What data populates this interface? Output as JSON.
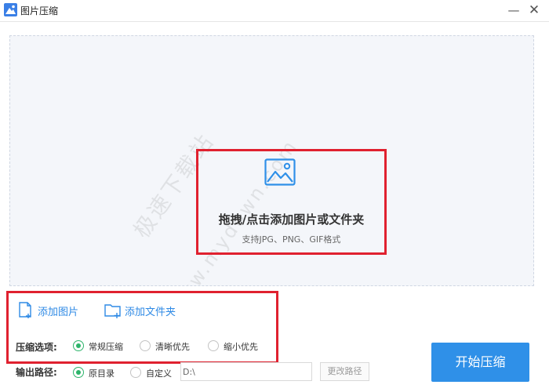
{
  "window": {
    "title": "图片压缩",
    "minimize_glyph": "—",
    "close_glyph": "✕"
  },
  "dropzone": {
    "title": "拖拽/点击添加图片或文件夹",
    "subtitle": "支持JPG、PNG、GIF格式",
    "icon": "image-icon",
    "watermark": "极速下载站",
    "watermark_url": "www.mydown.com"
  },
  "actions": {
    "add_image": "添加图片",
    "add_folder": "添加文件夹"
  },
  "compression": {
    "label": "压缩选项:",
    "options": [
      {
        "label": "常规压缩",
        "checked": true
      },
      {
        "label": "清晰优先",
        "checked": false
      },
      {
        "label": "缩小优先",
        "checked": false
      }
    ]
  },
  "output": {
    "label": "输出路径:",
    "options": [
      {
        "label": "原目录",
        "checked": true
      },
      {
        "label": "自定义",
        "checked": false
      }
    ],
    "path_value": "D:\\",
    "change_path_label": "更改路径"
  },
  "start_button": "开始压缩",
  "colors": {
    "accent": "#2f90e8",
    "link": "#2f8ae5",
    "radio_checked": "#2db46a",
    "highlight_border": "#e0212f"
  }
}
